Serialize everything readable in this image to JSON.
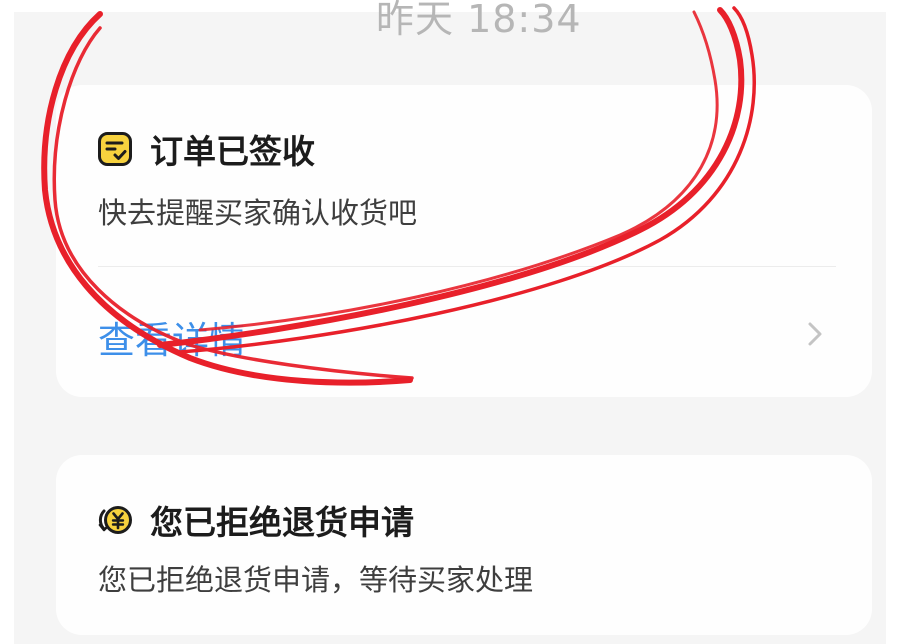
{
  "header": {
    "timestamp": "昨天 18:34"
  },
  "cards": [
    {
      "icon": "order-signed-icon",
      "title": "订单已签收",
      "subtitle": "快去提醒买家确认收货吧",
      "link_label": "查看详情",
      "link_icon": "chevron-right-icon"
    },
    {
      "icon": "refund-yen-icon",
      "title": "您已拒绝退货申请",
      "subtitle": "您已拒绝退货申请，等待买家处理"
    }
  ],
  "colors": {
    "link": "#3d8fe9",
    "icon_yellow": "#f7d23e",
    "annotation_red": "#e8202a",
    "background": "#f5f5f5",
    "card": "#fefefe"
  }
}
